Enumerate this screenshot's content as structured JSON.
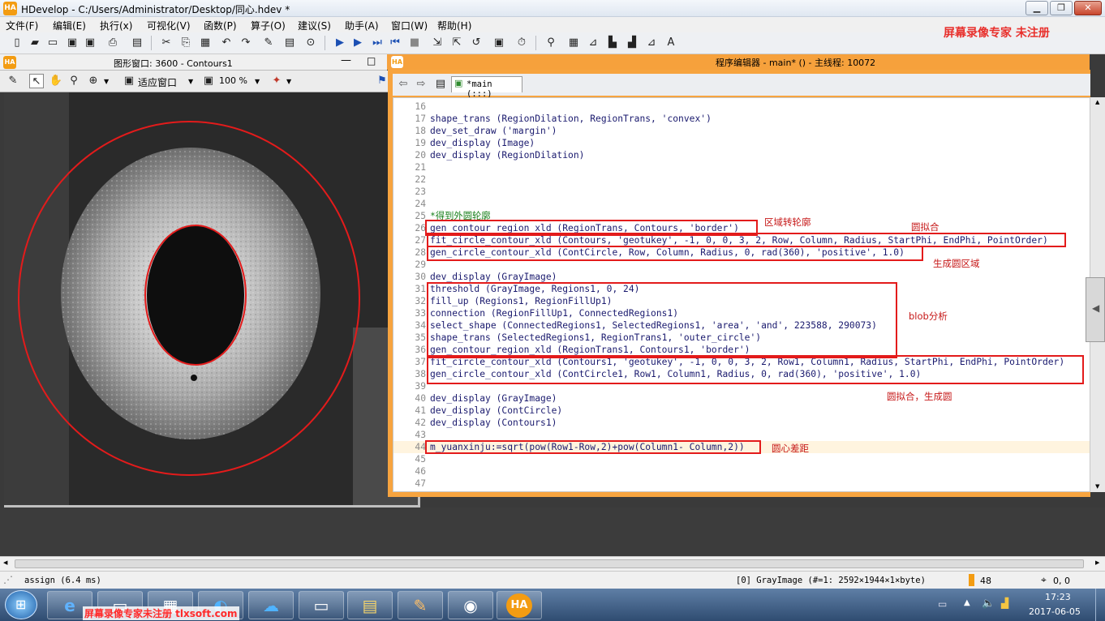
{
  "window": {
    "title": "HDevelop - C:/Users/Administrator/Desktop/同心.hdev *",
    "app_icon": "HA",
    "controls": [
      "minimize-icon",
      "restore-icon",
      "close-icon"
    ]
  },
  "menu": [
    "文件(F)",
    "编辑(E)",
    "执行(x)",
    "可视化(V)",
    "函数(P)",
    "算子(O)",
    "建议(S)",
    "助手(A)",
    "窗口(W)",
    "帮助(H)"
  ],
  "watermark_top": "屏幕录像专家 未注册",
  "graphics_window": {
    "title": "图形窗口: 3600 - Contours1",
    "fit_label": "适应窗口",
    "zoom_label": "100 %"
  },
  "editor": {
    "title": "程序编辑器 - main* () - 主线程: 10072",
    "tab_label": "*main (:::)",
    "lines": [
      {
        "n": "16",
        "code": "",
        "type": "code"
      },
      {
        "n": "17",
        "code": "shape_trans (RegionDilation, RegionTrans, 'convex')",
        "type": "code"
      },
      {
        "n": "18",
        "code": "dev_set_draw ('margin')",
        "type": "code"
      },
      {
        "n": "19",
        "code": "dev_display (Image)",
        "type": "code"
      },
      {
        "n": "20",
        "code": "dev_display (RegionDilation)",
        "type": "code"
      },
      {
        "n": "21",
        "code": "",
        "type": "code"
      },
      {
        "n": "22",
        "code": "",
        "type": "code"
      },
      {
        "n": "23",
        "code": "",
        "type": "code"
      },
      {
        "n": "24",
        "code": "",
        "type": "code"
      },
      {
        "n": "25",
        "code": "*得到外圆轮廓",
        "type": "comment"
      },
      {
        "n": "26",
        "code": "gen_contour_region_xld (RegionTrans, Contours, 'border')",
        "type": "code"
      },
      {
        "n": "27",
        "code": "fit_circle_contour_xld (Contours, 'geotukey', -1, 0, 0, 3, 2, Row, Column, Radius, StartPhi, EndPhi, PointOrder)",
        "type": "code"
      },
      {
        "n": "28",
        "code": "gen_circle_contour_xld (ContCircle, Row, Column, Radius, 0, rad(360), 'positive', 1.0)",
        "type": "code"
      },
      {
        "n": "29",
        "code": "",
        "type": "code"
      },
      {
        "n": "30",
        "code": "dev_display (GrayImage)",
        "type": "code"
      },
      {
        "n": "31",
        "code": "threshold (GrayImage, Regions1, 0, 24)",
        "type": "code"
      },
      {
        "n": "32",
        "code": "fill_up (Regions1, RegionFillUp1)",
        "type": "code"
      },
      {
        "n": "33",
        "code": "connection (RegionFillUp1, ConnectedRegions1)",
        "type": "code"
      },
      {
        "n": "34",
        "code": "select_shape (ConnectedRegions1, SelectedRegions1, 'area', 'and', 223588, 290073)",
        "type": "code"
      },
      {
        "n": "35",
        "code": "shape_trans (SelectedRegions1, RegionTrans1, 'outer_circle')",
        "type": "code"
      },
      {
        "n": "36",
        "code": "gen_contour_region_xld (RegionTrans1, Contours1, 'border')",
        "type": "code"
      },
      {
        "n": "37",
        "code": "fit_circle_contour_xld (Contours1, 'geotukey', -1, 0, 0, 3, 2, Row1, Column1, Radius, StartPhi, EndPhi, PointOrder)",
        "type": "code"
      },
      {
        "n": "38",
        "code": "gen_circle_contour_xld (ContCircle1, Row1, Column1, Radius, 0, rad(360), 'positive', 1.0)",
        "type": "code"
      },
      {
        "n": "39",
        "code": "",
        "type": "code"
      },
      {
        "n": "40",
        "code": "dev_display (GrayImage)",
        "type": "code"
      },
      {
        "n": "41",
        "code": "dev_display (ContCircle)",
        "type": "code"
      },
      {
        "n": "42",
        "code": "dev_display (Contours1)",
        "type": "code"
      },
      {
        "n": "43",
        "code": "",
        "type": "code"
      },
      {
        "n": "44",
        "code": "m_yuanxinju:=sqrt(pow(Row1-Row,2)+pow(Column1- Column,2))",
        "type": "current"
      },
      {
        "n": "45",
        "code": "",
        "type": "code"
      },
      {
        "n": "46",
        "code": "",
        "type": "code"
      },
      {
        "n": "47",
        "code": "",
        "type": "code"
      }
    ]
  },
  "annotations": {
    "a1": "区域转轮廓",
    "a2": "圆拟合",
    "a3": "生成圆区域",
    "a4": "blob分析",
    "a5": "圆拟合，生成圆",
    "a6": "圆心差距"
  },
  "status": {
    "left": "assign (6.4 ms)",
    "image_info": "[0] GrayImage (#=1: 2592×1944×1×byte)",
    "gray_value": "48",
    "coords": "0, 0"
  },
  "taskbar": {
    "watermark": "屏幕录像专家未注册 tlxsoft.com",
    "time": "17:23",
    "date": "2017-06-05",
    "apps": [
      "start-orb-icon",
      "ie-icon",
      "app-icon",
      "app-icon",
      "app-icon",
      "window-icon",
      "explorer-icon",
      "paint-icon",
      "eye-icon",
      "halcon-icon"
    ]
  },
  "colors": {
    "editor_accent": "#f6a13c",
    "annotation_red": "#e31b1b",
    "code_text": "#1a1a6e",
    "comment_green": "#18801c"
  }
}
